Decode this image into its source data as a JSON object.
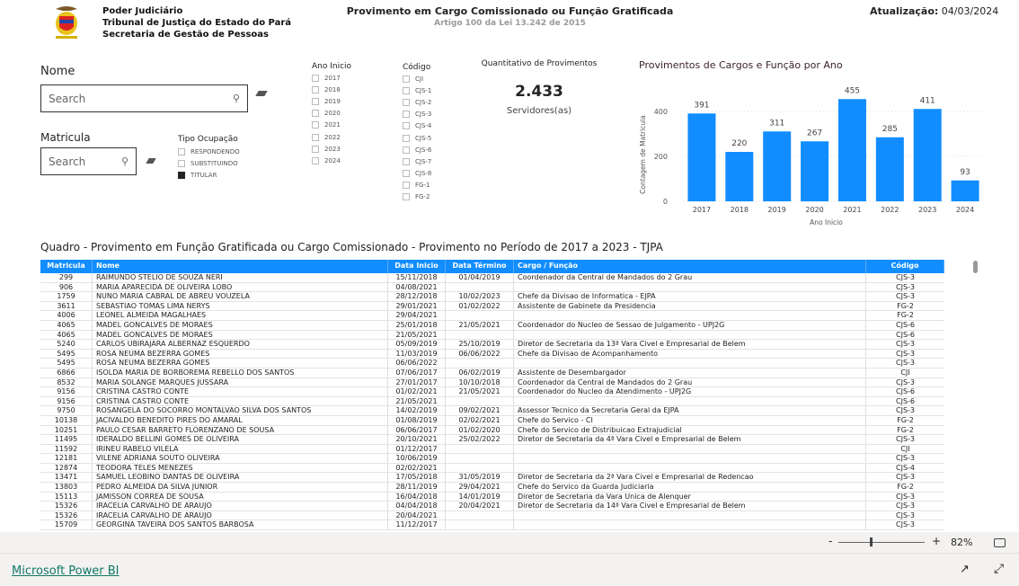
{
  "header": {
    "org_lines": [
      "Poder Judiciário",
      "Tribunal de Justiça do Estado do Pará",
      "Secretaria de Gestão de Pessoas"
    ],
    "title": "Provimento em Cargo Comissionado ou Função Gratificada",
    "subtitle": "Artigo 100 da Lei 13.242 de 2015",
    "update_label": "Atualização:",
    "update_date": "04/03/2024"
  },
  "filters": {
    "nome_label": "Nome",
    "nome_placeholder": "Search",
    "matricula_label": "Matricula",
    "matricula_placeholder": "Search",
    "tipo_label": "Tipo Ocupação",
    "tipo_options": [
      {
        "label": "RESPONDENDO",
        "checked": false
      },
      {
        "label": "SUBSTITUINDO",
        "checked": false
      },
      {
        "label": "TITULAR",
        "checked": true
      }
    ],
    "ano_label": "Ano Inicio",
    "ano_options": [
      "2017",
      "2018",
      "2019",
      "2020",
      "2021",
      "2022",
      "2023",
      "2024"
    ],
    "codigo_label": "Código",
    "codigo_options": [
      "CJI",
      "CJS-1",
      "CJS-2",
      "CJS-3",
      "CJS-4",
      "CJS-5",
      "CJS-6",
      "CJS-7",
      "CJS-8",
      "FG-1",
      "FG-2"
    ]
  },
  "card": {
    "title": "Quantitativo de Provimentos",
    "value": "2.433",
    "label": "Servidores(as)"
  },
  "chart_data": {
    "type": "bar",
    "title": "Provimentos de Cargos e Função por Ano",
    "xlabel": "Ano Inicio",
    "ylabel": "Contagem de Matricula",
    "categories": [
      "2017",
      "2018",
      "2019",
      "2020",
      "2021",
      "2022",
      "2023",
      "2024"
    ],
    "values": [
      391,
      220,
      311,
      267,
      455,
      285,
      411,
      93
    ],
    "yticks": [
      "0",
      "200",
      "400"
    ],
    "ylim": [
      0,
      480
    ],
    "grid": true,
    "color": "#118dff"
  },
  "table": {
    "title": "Quadro - Provimento em Função Gratificada ou Cargo Comissionado - Provimento no Período de 2017 a 2023 - TJPA",
    "columns": [
      "Matricula",
      "Nome",
      "Data Inicio",
      "Data Término",
      "Cargo / Função",
      "Código"
    ],
    "rows": [
      [
        "299",
        "RAIMUNDO STELIO DE SOUZA NERI",
        "15/11/2018",
        "01/04/2019",
        "Coordenador da Central de Mandados do 2 Grau",
        "CJS-3"
      ],
      [
        "906",
        "MARIA APARECIDA DE OLIVEIRA LOBO",
        "04/08/2021",
        "",
        "",
        "CJS-3"
      ],
      [
        "1759",
        "NUNO MARIA CABRAL DE ABREU VOUZELA",
        "28/12/2018",
        "10/02/2023",
        "Chefe da Divisao de Informatica - EJPA",
        "CJS-3"
      ],
      [
        "3611",
        "SEBASTIAO TOMAS LIMA NERYS",
        "29/01/2021",
        "01/02/2022",
        "Assistente de Gabinete da Presidencia",
        "FG-2"
      ],
      [
        "4006",
        "LEONEL ALMEIDA MAGALHAES",
        "29/04/2021",
        "",
        "",
        "FG-2"
      ],
      [
        "4065",
        "MADEL GONCALVES DE MORAES",
        "25/01/2018",
        "21/05/2021",
        "Coordenador do Nucleo de Sessao de Julgamento - UPJ2G",
        "CJS-6"
      ],
      [
        "4065",
        "MADEL GONCALVES DE MORAES",
        "21/05/2021",
        "",
        "",
        "CJS-6"
      ],
      [
        "5240",
        "CARLOS UBIRAJARA ALBERNAZ ESQUERDO",
        "05/09/2019",
        "25/10/2019",
        "Diretor de Secretaria da 13ª Vara Civel e Empresarial de Belem",
        "CJS-3"
      ],
      [
        "5495",
        "ROSA NEUMA BEZERRA GOMES",
        "11/03/2019",
        "06/06/2022",
        "Chefe da Divisao de Acompanhamento",
        "CJS-3"
      ],
      [
        "5495",
        "ROSA NEUMA BEZERRA GOMES",
        "06/06/2022",
        "",
        "",
        "CJS-3"
      ],
      [
        "6866",
        "ISOLDA MARIA DE BORBOREMA REBELLO DOS SANTOS",
        "07/06/2017",
        "06/02/2019",
        "Assistente de Desembargador",
        "CJI"
      ],
      [
        "8532",
        "MARIA SOLANGE MARQUES JUSSARA",
        "27/01/2017",
        "10/10/2018",
        "Coordenador da Central de Mandados do 2 Grau",
        "CJS-3"
      ],
      [
        "9156",
        "CRISTINA CASTRO CONTE",
        "01/02/2021",
        "21/05/2021",
        "Coordenador do Nucleo da Atendimento - UPJ2G",
        "CJS-6"
      ],
      [
        "9156",
        "CRISTINA CASTRO CONTE",
        "21/05/2021",
        "",
        "",
        "CJS-6"
      ],
      [
        "9750",
        "ROSANGELA DO SOCORRO MONTALVAO SILVA DOS SANTOS",
        "14/02/2019",
        "09/02/2021",
        "Assessor Tecnico da Secretaria Geral da EJPA",
        "CJS-3"
      ],
      [
        "10138",
        "JACIVALDO BENEDITO PIRES DO AMARAL",
        "01/08/2019",
        "02/02/2021",
        "Chefe do Servico - CI",
        "FG-2"
      ],
      [
        "10251",
        "PAULO CESAR BARRETO FLORENZANO DE SOUSA",
        "06/06/2017",
        "01/02/2020",
        "Chefe do Servico de Distribuicao Extrajudicial",
        "FG-2"
      ],
      [
        "11495",
        "IDERALDO BELLINI GOMES DE OLIVEIRA",
        "20/10/2021",
        "25/02/2022",
        "Diretor de Secretaria da 4ª Vara Civel e Empresarial de Belem",
        "CJS-3"
      ],
      [
        "11592",
        "IRINEU RABELO VILELA",
        "01/12/2017",
        "",
        "",
        "CJI"
      ],
      [
        "12181",
        "VILENE ADRIANA SOUTO OLIVEIRA",
        "10/06/2019",
        "",
        "",
        "CJS-3"
      ],
      [
        "12874",
        "TEODORA TELES MENEZES",
        "02/02/2021",
        "",
        "",
        "CJS-4"
      ],
      [
        "13471",
        "SAMUEL LEOBINO DANTAS DE OLIVEIRA",
        "17/05/2018",
        "31/05/2019",
        "Diretor de Secretaria da 2ª Vara Civel e Empresarial de Redencao",
        "CJS-3"
      ],
      [
        "13803",
        "PEDRO ALMEIDA DA SILVA JUNIOR",
        "28/11/2019",
        "29/04/2021",
        "Chefe do Servico da Guarda Judiciaria",
        "FG-2"
      ],
      [
        "15113",
        "JAMISSON CORREA DE SOUSA",
        "16/04/2018",
        "14/01/2019",
        "Diretor de Secretaria da Vara Unica de Alenquer",
        "CJS-3"
      ],
      [
        "15326",
        "IRACELIA CARVALHO DE ARAUJO",
        "04/04/2018",
        "20/04/2021",
        "Diretor de Secretaria da 14ª Vara Civel e Empresarial de Belem",
        "CJS-3"
      ],
      [
        "15326",
        "IRACELIA CARVALHO DE ARAUJO",
        "20/04/2021",
        "",
        "",
        "CJS-3"
      ],
      [
        "15709",
        "GEORGINA TAVEIRA DOS SANTOS BARBOSA",
        "11/12/2017",
        "",
        "",
        "CJS-3"
      ]
    ]
  },
  "zoom": {
    "minus": "-",
    "plus": "+",
    "level": "82%"
  },
  "footer": {
    "link": "Microsoft Power BI"
  }
}
